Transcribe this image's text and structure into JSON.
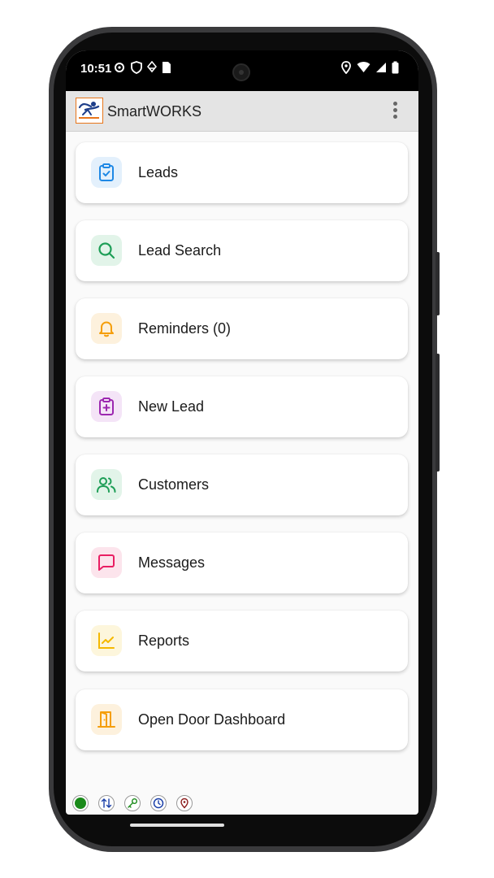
{
  "status_bar": {
    "time": "10:51"
  },
  "app": {
    "title": "SmartWORKS"
  },
  "menu": {
    "items": [
      {
        "label": "Leads",
        "icon": "clipboard-check-icon",
        "color": "#1e88e5",
        "bg": "#e3f0fc"
      },
      {
        "label": "Lead Search",
        "icon": "search-icon",
        "color": "#1e9e57",
        "bg": "#e2f4e9"
      },
      {
        "label": "Reminders (0)",
        "icon": "bell-icon",
        "color": "#f59e0b",
        "bg": "#fdf1dd"
      },
      {
        "label": "New Lead",
        "icon": "clipboard-plus-icon",
        "color": "#9c27b0",
        "bg": "#f4e4f7"
      },
      {
        "label": "Customers",
        "icon": "users-icon",
        "color": "#1e9e57",
        "bg": "#e2f4e9"
      },
      {
        "label": "Messages",
        "icon": "message-square-icon",
        "color": "#e91e63",
        "bg": "#fce4ec"
      },
      {
        "label": "Reports",
        "icon": "line-chart-icon",
        "color": "#f5b800",
        "bg": "#fdf6dc"
      },
      {
        "label": "Open Door Dashboard",
        "icon": "door-open-icon",
        "color": "#f59e0b",
        "bg": "#fdf1dd"
      }
    ]
  },
  "bottom_indicators": [
    {
      "name": "status-dot-icon",
      "color": "#1a8a1a"
    },
    {
      "name": "sync-arrows-icon",
      "color": "#1a3fa8"
    },
    {
      "name": "key-icon",
      "color": "#1a8a1a"
    },
    {
      "name": "clock-icon",
      "color": "#1a3fa8"
    },
    {
      "name": "location-pin-icon",
      "color": "#8b1a1a"
    }
  ]
}
